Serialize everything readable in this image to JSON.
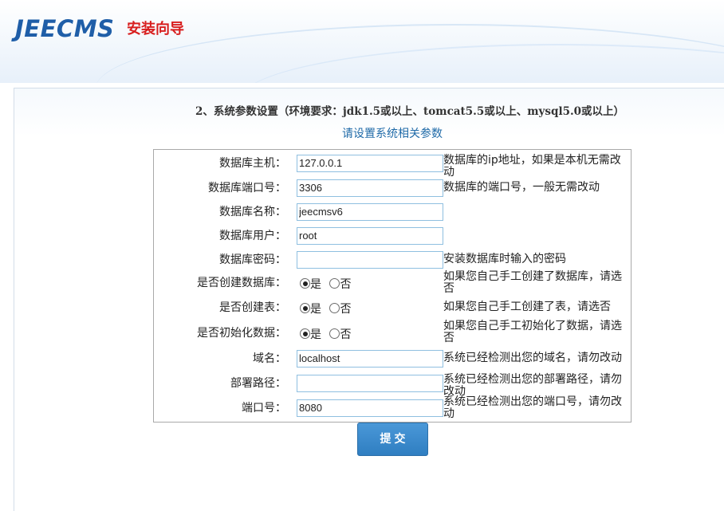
{
  "header": {
    "logo": "JEECMS",
    "subtitle": "安装向导"
  },
  "step": {
    "title": "2、系统参数设置（环境要求：jdk1.5或以上、tomcat5.5或以上、mysql5.0或以上）",
    "subtitle": "请设置系统相关参数"
  },
  "form": {
    "rows": [
      {
        "label": "数据库主机：",
        "value": "127.0.0.1",
        "hint": "数据库的ip地址，如果是本机无需改动"
      },
      {
        "label": "数据库端口号：",
        "value": "3306",
        "hint": "数据库的端口号，一般无需改动"
      },
      {
        "label": "数据库名称：",
        "value": "jeecmsv6",
        "hint": ""
      },
      {
        "label": "数据库用户：",
        "value": "root",
        "hint": ""
      },
      {
        "label": "数据库密码：",
        "value": "",
        "hint": "安装数据库时输入的密码"
      },
      {
        "label": "是否创建数据库：",
        "yes": "是",
        "no": "否",
        "hint": "如果您自己手工创建了数据库，请选否"
      },
      {
        "label": "是否创建表：",
        "yes": "是",
        "no": "否",
        "hint": "如果您自己手工创建了表，请选否"
      },
      {
        "label": "是否初始化数据：",
        "yes": "是",
        "no": "否",
        "hint": "如果您自己手工初始化了数据，请选否"
      },
      {
        "label": "域名：",
        "value": "localhost",
        "hint": "系统已经检测出您的域名，请勿改动"
      },
      {
        "label": "部署路径：",
        "value": "",
        "hint": "系统已经检测出您的部署路径，请勿改动"
      },
      {
        "label": "端口号：",
        "value": "8080",
        "hint": "系统已经检测出您的端口号，请勿改动"
      }
    ]
  },
  "submit_label": "提交",
  "colors": {
    "brand_blue": "#1f5ea8",
    "brand_red": "#d81e1e",
    "button_blue": "#3a8acb",
    "field_border": "#8fbfe0"
  }
}
